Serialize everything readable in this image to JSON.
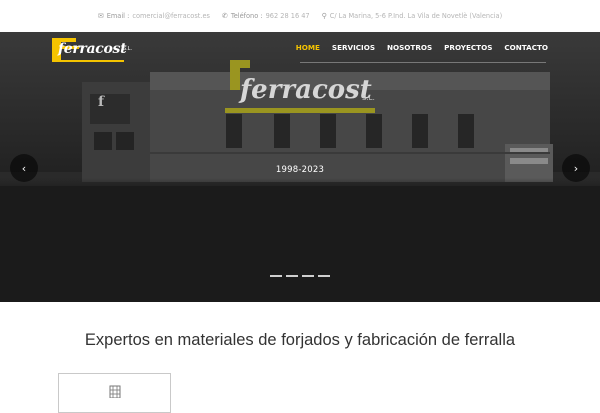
{
  "topbar": {
    "email_label": "Email :",
    "email_value": "comercial@ferracost.es",
    "phone_label": "Teléfono :",
    "phone_value": "962 28 16 47",
    "address": "C/ La Marina, 5-6 P.Ind. La Vila de Novetlè (Valencia)"
  },
  "brand": {
    "logo_text": "ferracost",
    "logo_suffix": "S.L."
  },
  "menu": [
    {
      "label": "HOME",
      "active": true
    },
    {
      "label": "SERVICIOS",
      "active": false
    },
    {
      "label": "NOSOTROS",
      "active": false
    },
    {
      "label": "PROYECTOS",
      "active": false
    },
    {
      "label": "CONTACTO",
      "active": false
    }
  ],
  "slider": {
    "caption": "1998-2023",
    "prev_arrow": "‹",
    "next_arrow": "›",
    "slide_count": 4
  },
  "main": {
    "heading": "Expertos en materiales de forjados y fabricación de ferralla"
  },
  "colors": {
    "accent": "#f5c400",
    "hero_bg": "#1b1b1b"
  },
  "icons": {
    "email": "envelope-icon",
    "phone": "phone-icon",
    "location": "map-pin-icon",
    "feature": "building-icon"
  }
}
